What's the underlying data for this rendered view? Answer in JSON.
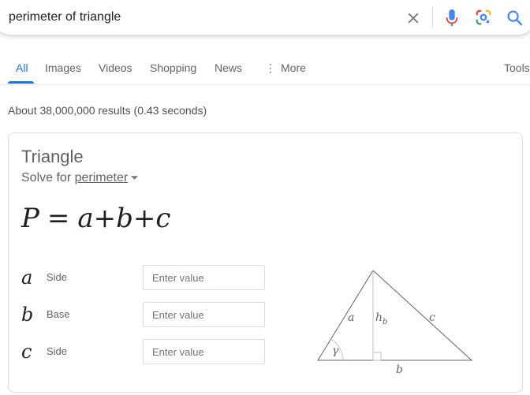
{
  "search": {
    "query": "perimeter of triangle"
  },
  "tabs": [
    {
      "label": "All",
      "active": true
    },
    {
      "label": "Images"
    },
    {
      "label": "Videos"
    },
    {
      "label": "Shopping"
    },
    {
      "label": "News"
    },
    {
      "label": "More"
    },
    {
      "label": "Tools"
    }
  ],
  "result_stats": "About 38,000,000 results (0.43 seconds)",
  "calculator": {
    "title": "Triangle",
    "solve_prefix": "Solve for",
    "solve_target": "perimeter",
    "formula": {
      "lhs": "P",
      "eq": "=",
      "rhs": "a+b+c"
    },
    "inputs": [
      {
        "symbol": "a",
        "label": "Side",
        "placeholder": "Enter value"
      },
      {
        "symbol": "b",
        "label": "Base",
        "placeholder": "Enter value"
      },
      {
        "symbol": "c",
        "label": "Side",
        "placeholder": "Enter value"
      }
    ],
    "diagram_labels": {
      "a": "a",
      "b": "b",
      "c": "c",
      "h": "h",
      "h_sub": "b",
      "angle": "γ"
    }
  },
  "colors": {
    "accent": "#1a73e8",
    "text_muted": "#5f6368"
  }
}
